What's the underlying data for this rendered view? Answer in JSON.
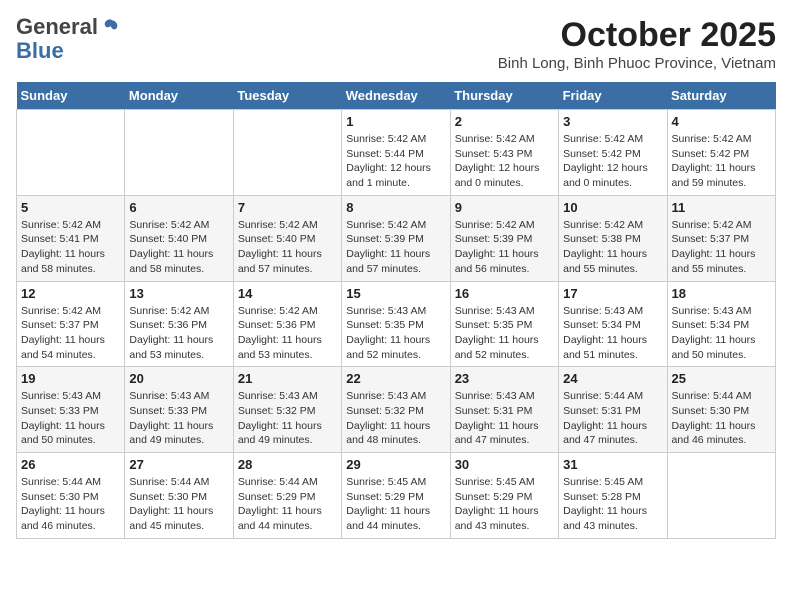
{
  "header": {
    "logo": {
      "general": "General",
      "blue": "Blue"
    },
    "title": "October 2025",
    "subtitle": "Binh Long, Binh Phuoc Province, Vietnam"
  },
  "days_of_week": [
    "Sunday",
    "Monday",
    "Tuesday",
    "Wednesday",
    "Thursday",
    "Friday",
    "Saturday"
  ],
  "weeks": [
    [
      {
        "day": "",
        "info": ""
      },
      {
        "day": "",
        "info": ""
      },
      {
        "day": "",
        "info": ""
      },
      {
        "day": "1",
        "info": "Sunrise: 5:42 AM\nSunset: 5:44 PM\nDaylight: 12 hours and 1 minute."
      },
      {
        "day": "2",
        "info": "Sunrise: 5:42 AM\nSunset: 5:43 PM\nDaylight: 12 hours and 0 minutes."
      },
      {
        "day": "3",
        "info": "Sunrise: 5:42 AM\nSunset: 5:42 PM\nDaylight: 12 hours and 0 minutes."
      },
      {
        "day": "4",
        "info": "Sunrise: 5:42 AM\nSunset: 5:42 PM\nDaylight: 11 hours and 59 minutes."
      }
    ],
    [
      {
        "day": "5",
        "info": "Sunrise: 5:42 AM\nSunset: 5:41 PM\nDaylight: 11 hours and 58 minutes."
      },
      {
        "day": "6",
        "info": "Sunrise: 5:42 AM\nSunset: 5:40 PM\nDaylight: 11 hours and 58 minutes."
      },
      {
        "day": "7",
        "info": "Sunrise: 5:42 AM\nSunset: 5:40 PM\nDaylight: 11 hours and 57 minutes."
      },
      {
        "day": "8",
        "info": "Sunrise: 5:42 AM\nSunset: 5:39 PM\nDaylight: 11 hours and 57 minutes."
      },
      {
        "day": "9",
        "info": "Sunrise: 5:42 AM\nSunset: 5:39 PM\nDaylight: 11 hours and 56 minutes."
      },
      {
        "day": "10",
        "info": "Sunrise: 5:42 AM\nSunset: 5:38 PM\nDaylight: 11 hours and 55 minutes."
      },
      {
        "day": "11",
        "info": "Sunrise: 5:42 AM\nSunset: 5:37 PM\nDaylight: 11 hours and 55 minutes."
      }
    ],
    [
      {
        "day": "12",
        "info": "Sunrise: 5:42 AM\nSunset: 5:37 PM\nDaylight: 11 hours and 54 minutes."
      },
      {
        "day": "13",
        "info": "Sunrise: 5:42 AM\nSunset: 5:36 PM\nDaylight: 11 hours and 53 minutes."
      },
      {
        "day": "14",
        "info": "Sunrise: 5:42 AM\nSunset: 5:36 PM\nDaylight: 11 hours and 53 minutes."
      },
      {
        "day": "15",
        "info": "Sunrise: 5:43 AM\nSunset: 5:35 PM\nDaylight: 11 hours and 52 minutes."
      },
      {
        "day": "16",
        "info": "Sunrise: 5:43 AM\nSunset: 5:35 PM\nDaylight: 11 hours and 52 minutes."
      },
      {
        "day": "17",
        "info": "Sunrise: 5:43 AM\nSunset: 5:34 PM\nDaylight: 11 hours and 51 minutes."
      },
      {
        "day": "18",
        "info": "Sunrise: 5:43 AM\nSunset: 5:34 PM\nDaylight: 11 hours and 50 minutes."
      }
    ],
    [
      {
        "day": "19",
        "info": "Sunrise: 5:43 AM\nSunset: 5:33 PM\nDaylight: 11 hours and 50 minutes."
      },
      {
        "day": "20",
        "info": "Sunrise: 5:43 AM\nSunset: 5:33 PM\nDaylight: 11 hours and 49 minutes."
      },
      {
        "day": "21",
        "info": "Sunrise: 5:43 AM\nSunset: 5:32 PM\nDaylight: 11 hours and 49 minutes."
      },
      {
        "day": "22",
        "info": "Sunrise: 5:43 AM\nSunset: 5:32 PM\nDaylight: 11 hours and 48 minutes."
      },
      {
        "day": "23",
        "info": "Sunrise: 5:43 AM\nSunset: 5:31 PM\nDaylight: 11 hours and 47 minutes."
      },
      {
        "day": "24",
        "info": "Sunrise: 5:44 AM\nSunset: 5:31 PM\nDaylight: 11 hours and 47 minutes."
      },
      {
        "day": "25",
        "info": "Sunrise: 5:44 AM\nSunset: 5:30 PM\nDaylight: 11 hours and 46 minutes."
      }
    ],
    [
      {
        "day": "26",
        "info": "Sunrise: 5:44 AM\nSunset: 5:30 PM\nDaylight: 11 hours and 46 minutes."
      },
      {
        "day": "27",
        "info": "Sunrise: 5:44 AM\nSunset: 5:30 PM\nDaylight: 11 hours and 45 minutes."
      },
      {
        "day": "28",
        "info": "Sunrise: 5:44 AM\nSunset: 5:29 PM\nDaylight: 11 hours and 44 minutes."
      },
      {
        "day": "29",
        "info": "Sunrise: 5:45 AM\nSunset: 5:29 PM\nDaylight: 11 hours and 44 minutes."
      },
      {
        "day": "30",
        "info": "Sunrise: 5:45 AM\nSunset: 5:29 PM\nDaylight: 11 hours and 43 minutes."
      },
      {
        "day": "31",
        "info": "Sunrise: 5:45 AM\nSunset: 5:28 PM\nDaylight: 11 hours and 43 minutes."
      },
      {
        "day": "",
        "info": ""
      }
    ]
  ]
}
